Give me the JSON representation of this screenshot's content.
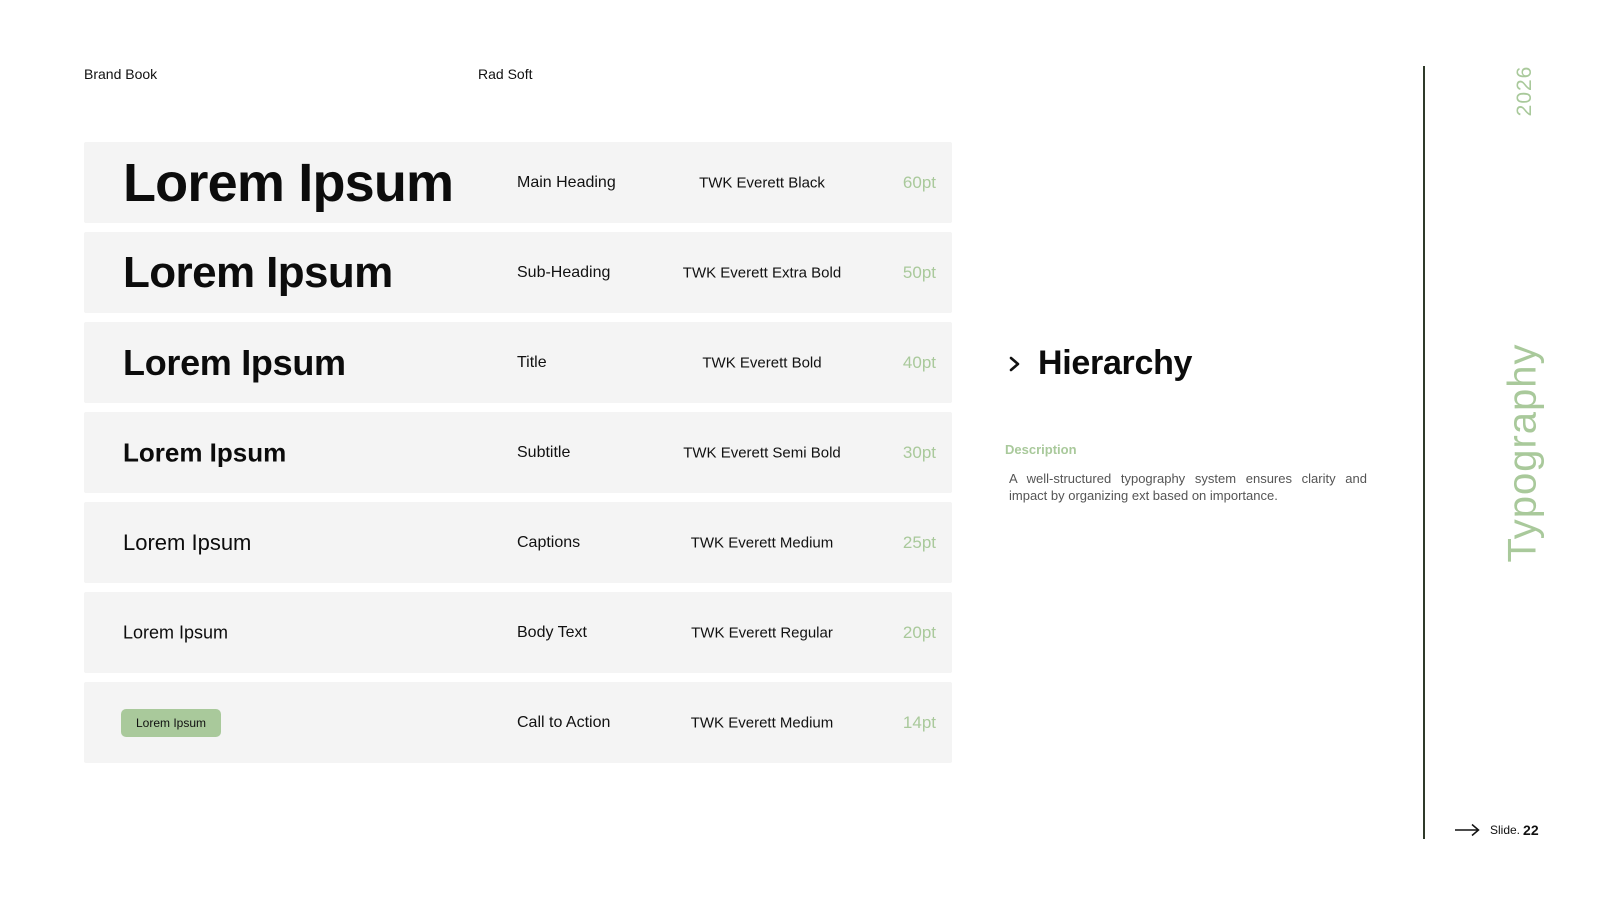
{
  "header": {
    "left_label": "Brand Book",
    "center_label": "Rad Soft"
  },
  "type_scale": {
    "rows": [
      {
        "sample": "Lorem Ipsum",
        "usage": "Main Heading",
        "font": "TWK Everett Black",
        "size": "60pt"
      },
      {
        "sample": "Lorem Ipsum",
        "usage": "Sub-Heading",
        "font": "TWK Everett Extra Bold",
        "size": "50pt"
      },
      {
        "sample": "Lorem Ipsum",
        "usage": "Title",
        "font": "TWK Everett Bold",
        "size": "40pt"
      },
      {
        "sample": "Lorem Ipsum",
        "usage": "Subtitle",
        "font": "TWK Everett Semi Bold",
        "size": "30pt"
      },
      {
        "sample": "Lorem Ipsum",
        "usage": "Captions",
        "font": "TWK Everett Medium",
        "size": "25pt"
      },
      {
        "sample": "Lorem Ipsum",
        "usage": "Body Text",
        "font": "TWK Everett Regular",
        "size": "20pt"
      },
      {
        "sample": "Lorem Ipsum",
        "usage": "Call to Action",
        "font": "TWK Everett Medium",
        "size": "14pt"
      }
    ]
  },
  "section": {
    "icon": "chevron-right-icon",
    "title": "Hierarchy",
    "description_label": "Description",
    "description": "A well-structured typography system ensures clarity and impact by organizing ext based on importance."
  },
  "sidebar": {
    "year": "2026",
    "title": "Typography"
  },
  "footer": {
    "icon": "arrow-right-icon",
    "slide_label": "Slide.",
    "slide_number": "22"
  },
  "colors": {
    "accent": "#a9c99b",
    "row_background": "#f4f4f4",
    "divider": "#2f3a2a",
    "text": "#111111"
  }
}
